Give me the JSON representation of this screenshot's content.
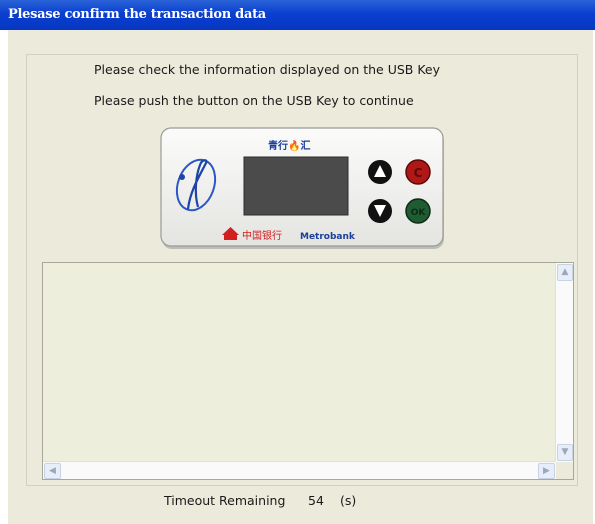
{
  "window": {
    "title": "Plesase confirm the transaction data"
  },
  "messages": {
    "check_info": "Please check the information displayed on the USB Key",
    "push_button": "Please push the button on the USB Key to continue"
  },
  "usb_key": {
    "brand_top": "青行🔥汇",
    "bank_name_cn": "中国银行",
    "bank_name_en": "Metrobank",
    "button_c": "C",
    "button_ok": "OK",
    "colors": {
      "body": "#f2f2f0",
      "screen": "#4b4b4b",
      "up_down_buttons": "#111111",
      "cancel_button": "#b01818",
      "ok_button": "#1f5c32",
      "bank_red": "#d22020",
      "bank_blue": "#1b3f9a"
    }
  },
  "output_box": {
    "value": ""
  },
  "timeout": {
    "label": "Timeout Remaining",
    "value": "54",
    "unit": "(s)"
  },
  "colors": {
    "titlebar": "#0b3fd0",
    "client_bg": "#eceadb"
  }
}
